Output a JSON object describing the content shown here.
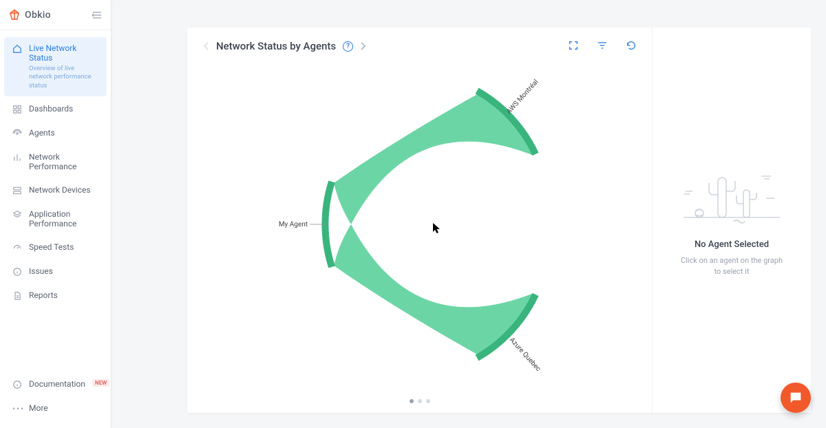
{
  "brand": {
    "name": "Obkio"
  },
  "sidebar": {
    "items": [
      {
        "label": "Live Network Status",
        "subtitle": "Overview of live network performance status",
        "icon": "home"
      },
      {
        "label": "Dashboards",
        "icon": "dashboard"
      },
      {
        "label": "Agents",
        "icon": "broadcast"
      },
      {
        "label": "Network Performance",
        "icon": "bars"
      },
      {
        "label": "Network Devices",
        "icon": "server"
      },
      {
        "label": "Application Performance",
        "icon": "layers"
      },
      {
        "label": "Speed Tests",
        "icon": "gauge"
      },
      {
        "label": "Issues",
        "icon": "info"
      },
      {
        "label": "Reports",
        "icon": "doc"
      }
    ],
    "footer": [
      {
        "label": "Documentation",
        "icon": "info",
        "badge": "NEW"
      },
      {
        "label": "More",
        "icon": "dots"
      }
    ]
  },
  "header": {
    "title": "Network Status by Agents"
  },
  "chart_data": {
    "type": "chord",
    "title": "Network Status by Agents",
    "nodes": [
      "My Agent",
      "AWS Montréal",
      "Azure Quebec"
    ],
    "links": [
      {
        "source": "My Agent",
        "target": "AWS Montréal",
        "status": "ok"
      },
      {
        "source": "My Agent",
        "target": "Azure Quebec",
        "status": "ok"
      }
    ],
    "status_color": {
      "ok": "#48c78e"
    }
  },
  "pager": {
    "count": 3,
    "active": 0
  },
  "detail": {
    "title": "No Agent Selected",
    "subtitle": "Click on an agent on the graph to select it"
  }
}
